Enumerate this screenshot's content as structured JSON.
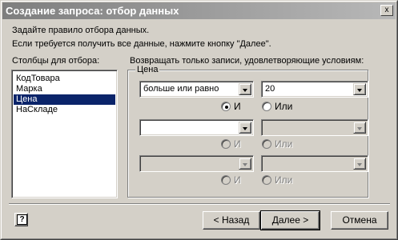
{
  "window": {
    "title": "Создание запроса: отбор данных",
    "close_glyph": "x"
  },
  "instructions": {
    "line1": "Задайте правило отбора данных.",
    "line2": "Если требуется получить все данные, нажмите кнопку \"Далее\"."
  },
  "columns": {
    "label": "Столбцы для отбора:",
    "items": [
      "КодТовара",
      "Марка",
      "Цена",
      "НаСкладе"
    ],
    "selected_index": 2
  },
  "filter": {
    "label": "Возвращать только записи, удовлетворяющие условиям:",
    "group_label": "Цена",
    "row1": {
      "operator": "больше или равно",
      "value": "20"
    },
    "radio1": {
      "and_label": "И",
      "or_label": "Или",
      "selected": "and"
    },
    "row2": {
      "operator": "",
      "value": ""
    },
    "radio2": {
      "and_label": "И",
      "or_label": "Или"
    },
    "row3": {
      "operator": "",
      "value": ""
    },
    "radio3": {
      "and_label": "И",
      "or_label": "Или"
    }
  },
  "buttons": {
    "help_glyph": "?",
    "back": "< Назад",
    "next": "Далее >",
    "cancel": "Отмена"
  }
}
